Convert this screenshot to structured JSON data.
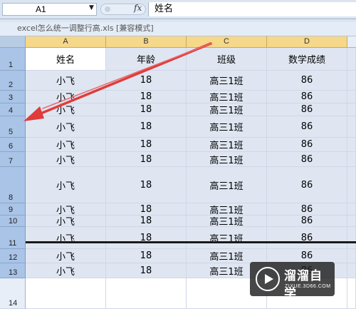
{
  "formula_bar": {
    "name_box": "A1",
    "fx_label": "fx",
    "content": "姓名"
  },
  "document": {
    "title": "excel怎么统一调整行高.xls  [兼容模式]"
  },
  "columns": [
    "A",
    "B",
    "C",
    "D"
  ],
  "rows": [
    {
      "num": "1",
      "cells": [
        "姓名",
        "年龄",
        "班级",
        "数学成绩"
      ]
    },
    {
      "num": "2",
      "cells": [
        "小飞",
        "18",
        "高三1班",
        "86"
      ]
    },
    {
      "num": "3",
      "cells": [
        "小飞",
        "18",
        "高三1班",
        "86"
      ]
    },
    {
      "num": "4",
      "cells": [
        "小飞",
        "18",
        "高三1班",
        "86"
      ]
    },
    {
      "num": "5",
      "cells": [
        "小飞",
        "18",
        "高三1班",
        "86"
      ]
    },
    {
      "num": "6",
      "cells": [
        "小飞",
        "18",
        "高三1班",
        "86"
      ]
    },
    {
      "num": "7",
      "cells": [
        "小飞",
        "18",
        "高三1班",
        "86"
      ]
    },
    {
      "num": "8",
      "cells": [
        "小飞",
        "18",
        "高三1班",
        "86"
      ]
    },
    {
      "num": "9",
      "cells": [
        "小飞",
        "18",
        "高三1班",
        "86"
      ]
    },
    {
      "num": "10",
      "cells": [
        "小飞",
        "18",
        "高三1班",
        "86"
      ]
    },
    {
      "num": "11",
      "cells": [
        "小飞",
        "18",
        "高三1班",
        "86"
      ]
    },
    {
      "num": "12",
      "cells": [
        "小飞",
        "18",
        "高三1班",
        "86"
      ]
    },
    {
      "num": "13",
      "cells": [
        "小飞",
        "18",
        "高三1班",
        "86"
      ]
    },
    {
      "num": "14",
      "cells": [
        "",
        "",
        "",
        ""
      ]
    }
  ],
  "watermark": {
    "title": "溜溜自学",
    "subtitle": "ZIXUE.3D66.COM"
  },
  "colors": {
    "selection_fill": "#dfe6f2",
    "selected_row_header": "#a9c4e6",
    "selected_col_header": "#f5d88a",
    "annotation_arrow": "#e03c3c"
  }
}
